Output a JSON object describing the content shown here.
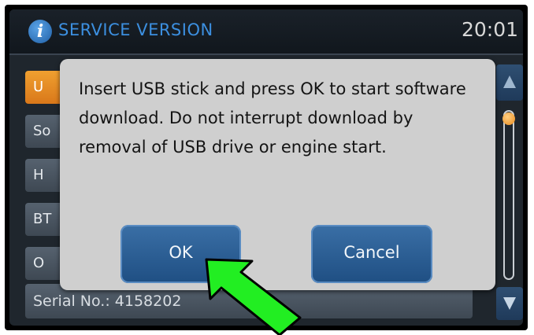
{
  "header": {
    "title": "SERVICE VERSION",
    "clock": "20:01",
    "info_icon": "info-icon",
    "info_glyph": "i"
  },
  "list": {
    "items": [
      {
        "label": "U",
        "active": true
      },
      {
        "label": "So",
        "active": false
      },
      {
        "label": "H",
        "active": false
      },
      {
        "label": "BT",
        "active": false
      },
      {
        "label": "O",
        "active": false
      }
    ],
    "serial": "Serial No.: 4158202"
  },
  "dialog": {
    "message": "Insert USB stick and press OK to start software download. Do not interrupt download by removal of USB drive or engine start.",
    "ok_label": "OK",
    "cancel_label": "Cancel"
  },
  "colors": {
    "accent_blue": "#3c8fe0",
    "active_orange": "#e8861f",
    "pointer_green": "#22ee22"
  },
  "icons": {
    "scroll_up": "chevron-up-icon",
    "scroll_down": "chevron-down-icon",
    "pointer": "arrow-pointer-icon"
  }
}
